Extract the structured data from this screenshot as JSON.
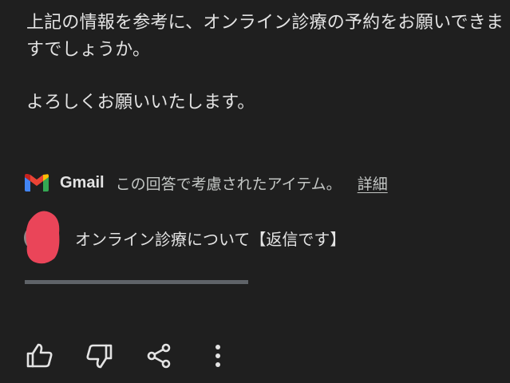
{
  "response": {
    "paragraph1": "上記の情報を参考に、オンライン診療の予約をお願いできますでしょうか。",
    "paragraph2": "よろしくお願いいたします。"
  },
  "sources": {
    "app_label": "Gmail",
    "description": "この回答で考慮されたアイテム。",
    "details_link": "詳細",
    "items": [
      {
        "title": "オンライン診療について【返信です】",
        "icon": "sender-avatar-redacted"
      }
    ],
    "scroll_progress": 1.0
  },
  "actions": {
    "icons": [
      "thumbs-up-icon",
      "thumbs-down-icon",
      "share-icon",
      "more-vert-icon"
    ]
  },
  "colors": {
    "background": "#1f1f1f",
    "text": "#e3e3e3",
    "secondary_text": "#c4c7c5",
    "redaction": "#ea4559",
    "gmail_red": "#ea4335",
    "gmail_blue": "#4285f4",
    "gmail_green": "#34a853",
    "gmail_yellow": "#fbbc04",
    "gmail_dark_red": "#c5221f"
  }
}
